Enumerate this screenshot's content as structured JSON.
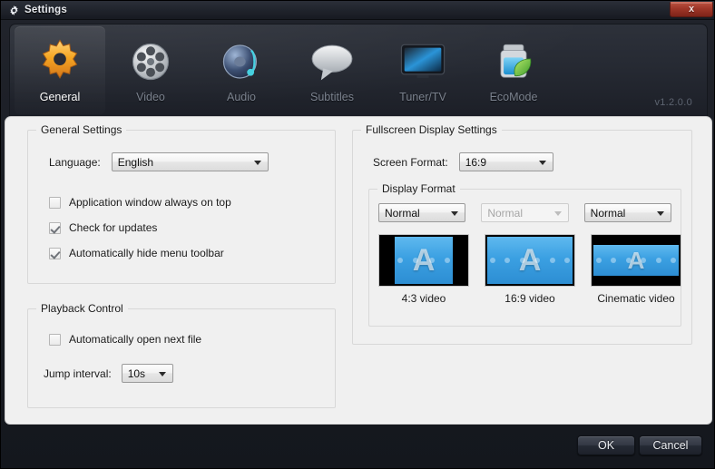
{
  "window": {
    "title": "Settings",
    "icon": "gear-icon",
    "close_label": "x",
    "version": "v1.2.0.0"
  },
  "tabs": [
    {
      "label": "General",
      "icon": "gear-icon",
      "active": true
    },
    {
      "label": "Video",
      "icon": "film-reel-icon",
      "active": false
    },
    {
      "label": "Audio",
      "icon": "speaker-icon",
      "active": false
    },
    {
      "label": "Subtitles",
      "icon": "speech-bubble-icon",
      "active": false
    },
    {
      "label": "Tuner/TV",
      "icon": "television-icon",
      "active": false
    },
    {
      "label": "EcoMode",
      "icon": "battery-leaf-icon",
      "active": false
    }
  ],
  "general_settings": {
    "group_title": "General Settings",
    "language_label": "Language:",
    "language_value": "English",
    "language_options": [
      "English"
    ],
    "checkboxes": [
      {
        "label": "Application window always on top",
        "checked": false
      },
      {
        "label": "Check for updates",
        "checked": true
      },
      {
        "label": "Automatically hide menu toolbar",
        "checked": true
      }
    ]
  },
  "playback_control": {
    "group_title": "Playback Control",
    "checkboxes": [
      {
        "label": "Automatically open next file",
        "checked": false
      }
    ],
    "jump_interval_label": "Jump interval:",
    "jump_interval_value": "10s",
    "jump_interval_options": [
      "10s"
    ]
  },
  "fullscreen_display": {
    "group_title": "Fullscreen Display Settings",
    "screen_format_label": "Screen Format:",
    "screen_format_value": "16:9",
    "screen_format_options": [
      "16:9"
    ],
    "display_format": {
      "group_title": "Display Format",
      "selectors": [
        {
          "value": "Normal",
          "disabled": false
        },
        {
          "value": "Normal",
          "disabled": true
        },
        {
          "value": "Normal",
          "disabled": false
        }
      ],
      "previews": [
        {
          "caption": "4:3 video",
          "mode": "pillarbox",
          "letter": "A"
        },
        {
          "caption": "16:9 video",
          "mode": "full",
          "letter": "A"
        },
        {
          "caption": "Cinematic video",
          "mode": "letterbox",
          "letter": "A"
        }
      ]
    }
  },
  "footer": {
    "ok_label": "OK",
    "cancel_label": "Cancel"
  },
  "colors": {
    "accent_orange": "#f0a030",
    "video_blue": "#3ba0e2",
    "close_red": "#9e3527",
    "panel_bg": "#f0f0f0"
  }
}
